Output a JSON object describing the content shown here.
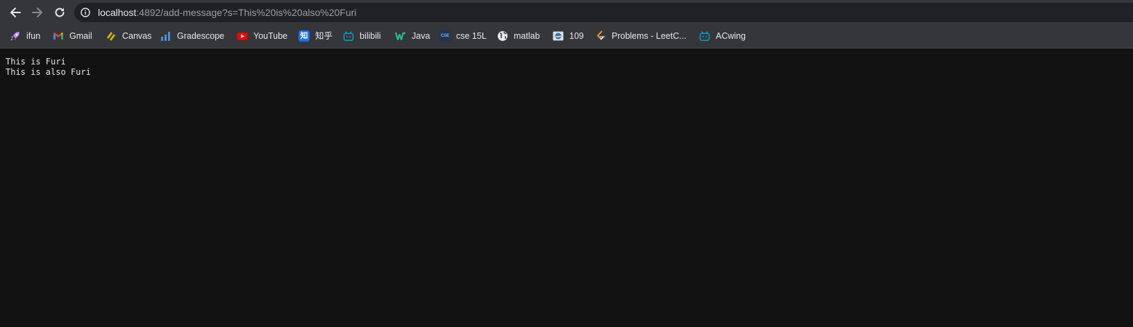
{
  "toolbar": {
    "url_host": "localhost",
    "url_rest": ":4892/add-message?s=This%20is%20also%20Furi"
  },
  "bookmarks": [
    {
      "label": "ifun",
      "icon": "rocket-icon"
    },
    {
      "label": "Gmail",
      "icon": "gmail-icon"
    },
    {
      "label": "Canvas",
      "icon": "canvas-icon"
    },
    {
      "label": "Gradescope",
      "icon": "gradescope-icon"
    },
    {
      "label": "YouTube",
      "icon": "youtube-icon"
    },
    {
      "label": "知乎",
      "icon": "zhihu-icon",
      "icon_text": "知"
    },
    {
      "label": "bilibili",
      "icon": "bilibili-icon"
    },
    {
      "label": "Java",
      "icon": "java-icon"
    },
    {
      "label": "cse 15L",
      "icon": "cse-icon",
      "icon_text": "CSE"
    },
    {
      "label": "matlab",
      "icon": "globe-icon"
    },
    {
      "label": "109",
      "icon": "image-icon"
    },
    {
      "label": "Problems - LeetC...",
      "icon": "leetcode-icon"
    },
    {
      "label": "ACwing",
      "icon": "bilibili-icon"
    }
  ],
  "page": {
    "lines": [
      "This is Furi",
      "This is also Furi"
    ]
  },
  "colors": {
    "toolbar_bg": "#35363a",
    "omnibox_bg": "#202124",
    "page_bg": "#121212",
    "text": "#e8eaed"
  }
}
